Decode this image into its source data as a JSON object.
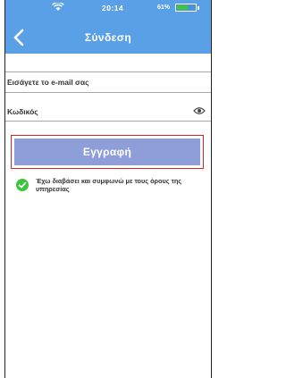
{
  "status_bar": {
    "time": "20:14",
    "battery_text": "61%",
    "battery_level": 0.61,
    "icons": [
      "wifi-icon",
      "battery-icon"
    ]
  },
  "header": {
    "title": "Σύνδεση",
    "back_icon": "chevron-left-icon",
    "background_color": "#5aa0e6"
  },
  "form": {
    "email_placeholder": "Εισάγετε το e-mail σας",
    "email_value": "",
    "password_placeholder": "Κωδικός",
    "password_value": "",
    "eye_icon": "eye-icon"
  },
  "register": {
    "label": "Εγγραφή",
    "button_color": "#8e9ed8",
    "highlight_color": "#e02020"
  },
  "terms": {
    "checked": true,
    "check_icon": "checkmark-circle-icon",
    "check_color": "#3ec43e",
    "text": "Έχω διαβάσει και συμφωνώ με τους όρους της υπηρεσίας"
  }
}
